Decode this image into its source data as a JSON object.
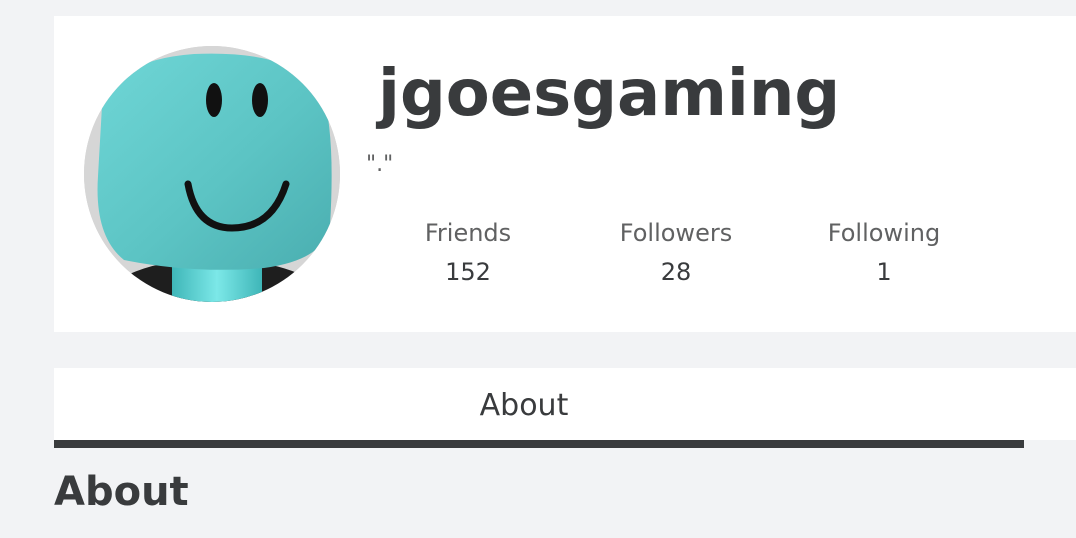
{
  "profile": {
    "username": "jgoesgaming",
    "status": "\".\"",
    "avatar_icon": "smiley-avatar-icon",
    "stats": [
      {
        "label": "Friends",
        "value": "152"
      },
      {
        "label": "Followers",
        "value": "28"
      },
      {
        "label": "Following",
        "value": "1"
      }
    ]
  },
  "tabs": [
    {
      "label": "About"
    }
  ],
  "section": {
    "title": "About"
  },
  "colors": {
    "background": "#f2f3f5",
    "card": "#ffffff",
    "text": "#393b3d",
    "muted_text": "#606162",
    "avatar_face": "#5cc4c4"
  }
}
